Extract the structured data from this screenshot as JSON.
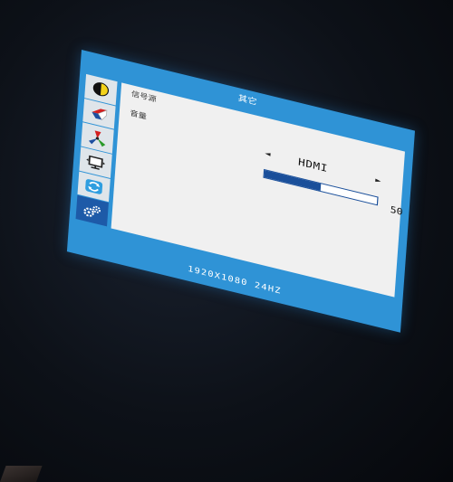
{
  "osd": {
    "title": "其它",
    "resolution": "1920X1080 24HZ"
  },
  "tabs": [
    {
      "icon": "brightness-icon",
      "active": false
    },
    {
      "icon": "image-icon",
      "active": false
    },
    {
      "icon": "color-icon",
      "active": false
    },
    {
      "icon": "display-icon",
      "active": false
    },
    {
      "icon": "reset-icon",
      "active": false
    },
    {
      "icon": "settings-icon",
      "active": true
    }
  ],
  "settings": {
    "signal_source_label": "信号源",
    "signal_source_value": "HDMI",
    "left_arrow": "◄",
    "right_arrow": "►",
    "volume_label": "音量",
    "volume_value": "50",
    "volume_fraction": 0.5
  },
  "colors": {
    "osd_frame": "#2f93d6",
    "active_tab": "#1d5aa8",
    "content_bg": "#f0f0f0"
  }
}
